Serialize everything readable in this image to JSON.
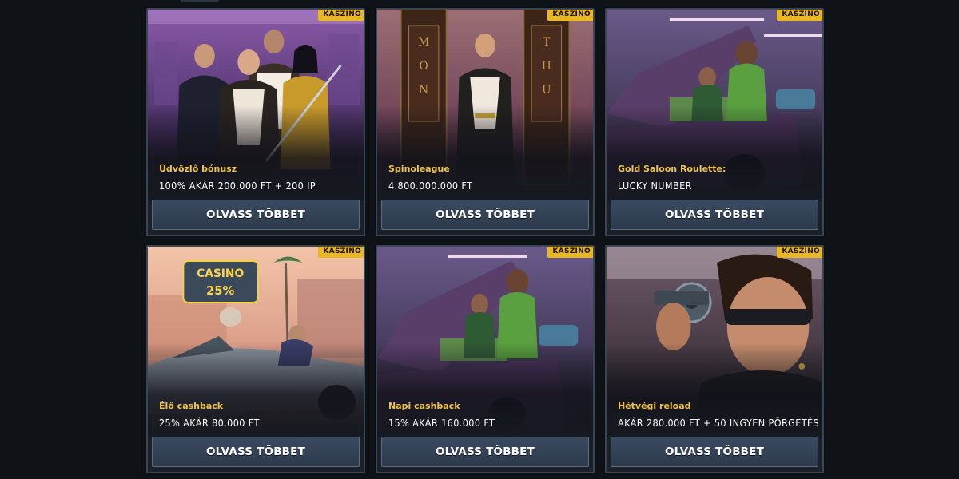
{
  "badge_label": "KASZINÓ",
  "button_label": "OLVASS TÖBBET",
  "cards": [
    {
      "subtitle": "Üdvözlő bónusz",
      "offer": "100% AKÁR 200.000 FT + 200 IP",
      "art": "gangster-crew"
    },
    {
      "subtitle": "Spinoleague",
      "offer": "4.800.000.000 FT",
      "art": "doors-mon-thu",
      "door_left": "MON",
      "door_right": "THU"
    },
    {
      "subtitle": "Gold Saloon Roulette:",
      "offer": "LUCKY NUMBER",
      "art": "car-trunk-cash"
    },
    {
      "subtitle": "Élő cashback",
      "offer": "25% AKÁR 80.000 FT",
      "art": "convertible-casino",
      "sign_top": "CASINO",
      "sign_bottom": "25%"
    },
    {
      "subtitle": "Napi cashback",
      "offer": "15% AKÁR 160.000 FT",
      "art": "car-trunk-cash"
    },
    {
      "subtitle": "Hétvégi reload",
      "offer": "AKÁR 280.000 FT + 50 INGYEN PÖRGETÉS",
      "art": "man-revolver"
    }
  ],
  "colors": {
    "badge": "#e9b722",
    "subtitle": "#f1c44a",
    "button": "#33425a",
    "background": "#0f1318"
  }
}
